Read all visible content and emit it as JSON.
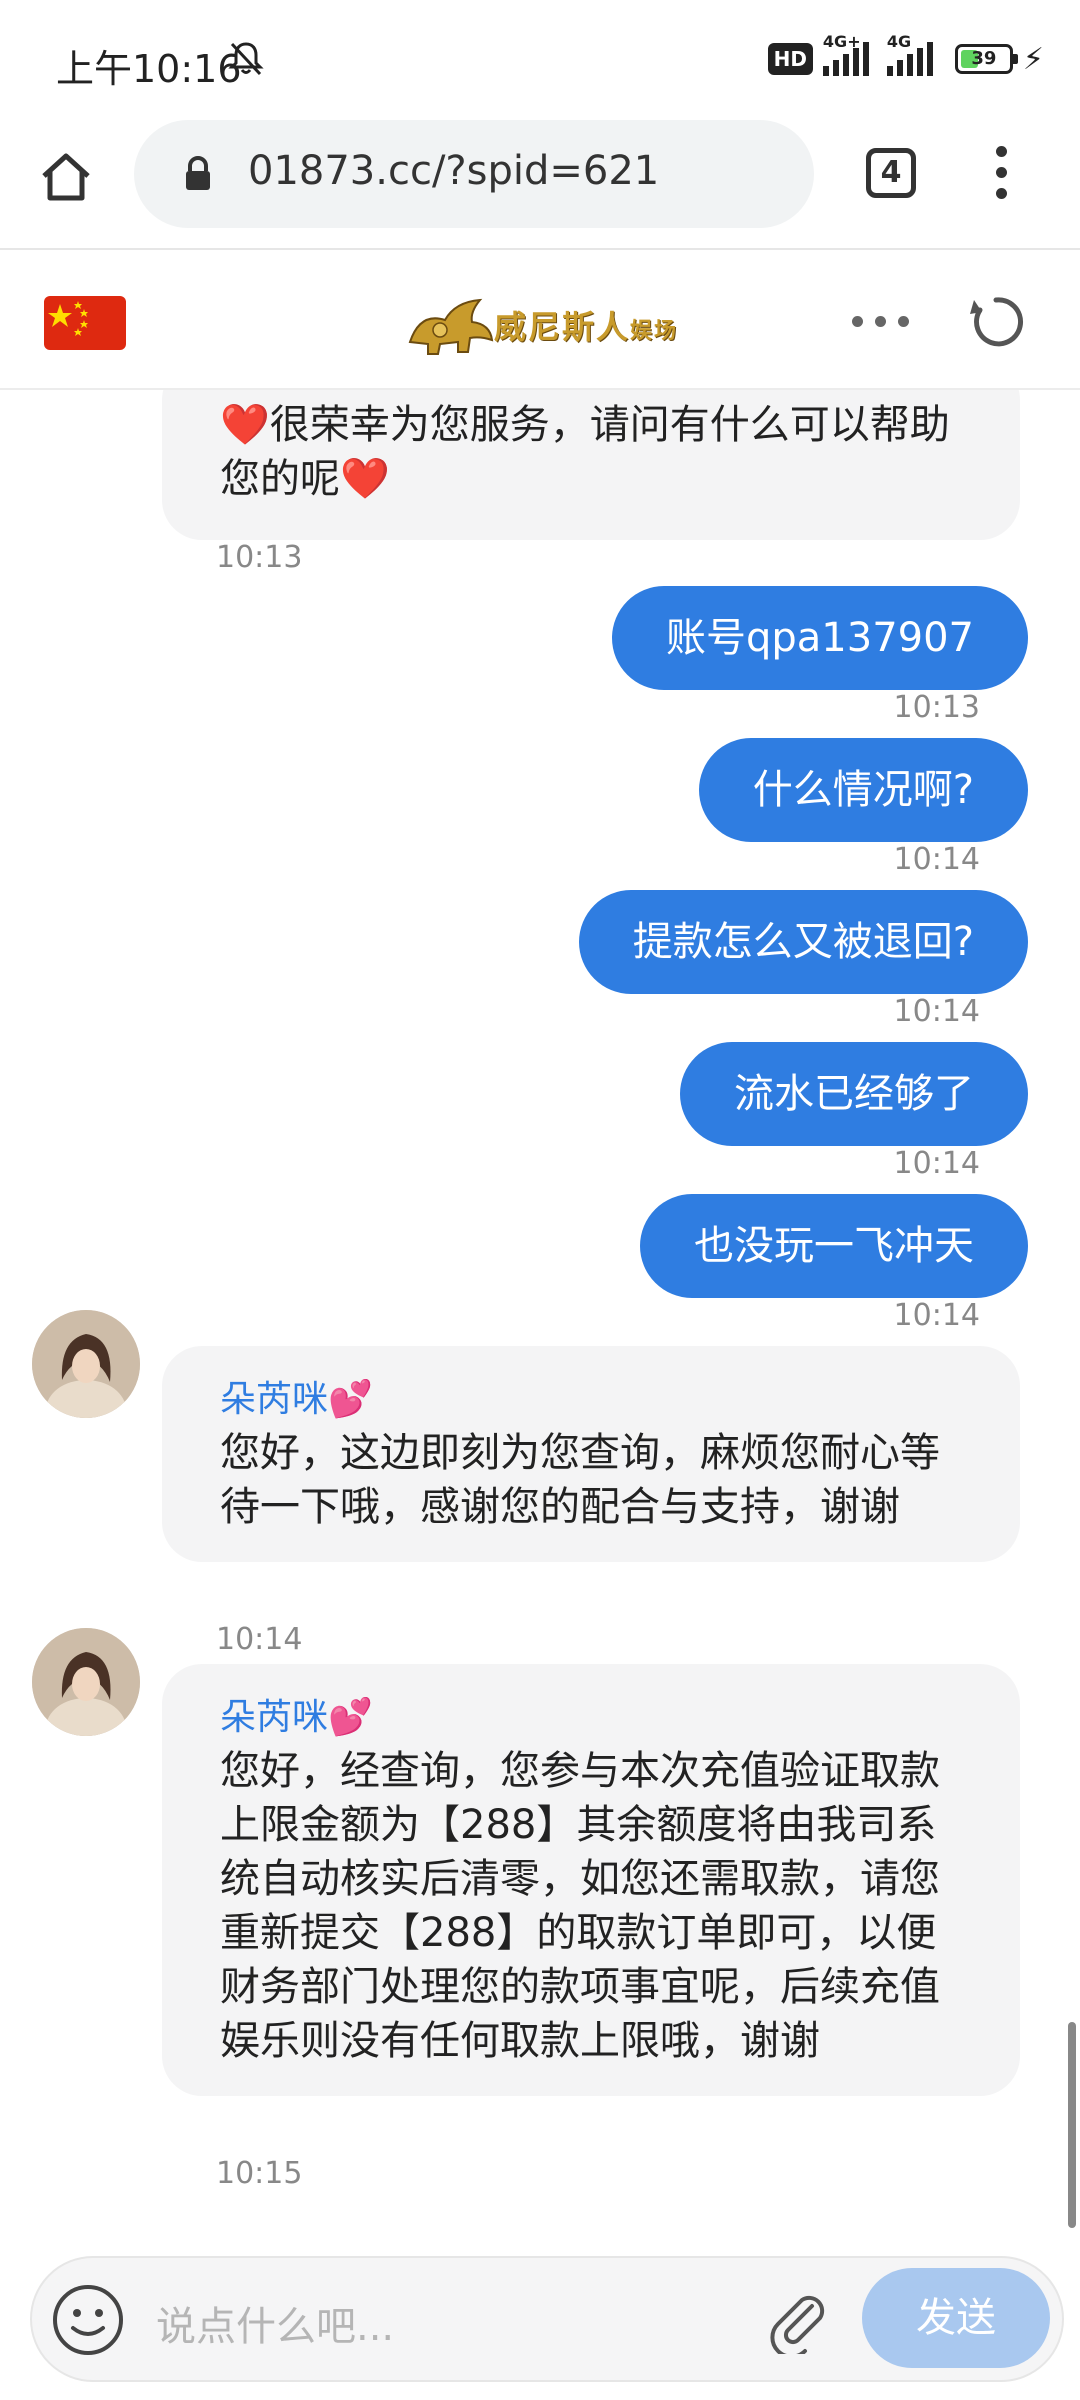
{
  "status_bar": {
    "time": "上午10:16",
    "hd": "HD",
    "sig1_label": "4G+",
    "sig2_label": "4G",
    "battery": "39",
    "battery_level": 0.39
  },
  "browser": {
    "url": "01873.cc/?spid=621",
    "tab_count": "4"
  },
  "app_header": {
    "brand": "威尼斯人",
    "brand_suffix": "娱场"
  },
  "messages": [
    {
      "side": "in",
      "text": "❤️很荣幸为您服务，请问有什么可以帮助您的呢❤️",
      "time": "10:13"
    },
    {
      "side": "out",
      "text": "账号qpa137907",
      "time": "10:13"
    },
    {
      "side": "out",
      "text": "什么情况啊?",
      "time": "10:14"
    },
    {
      "side": "out",
      "text": "提款怎么又被退回?",
      "time": "10:14"
    },
    {
      "side": "out",
      "text": "流水已经够了",
      "time": "10:14"
    },
    {
      "side": "out",
      "text": "也没玩一飞冲天",
      "time": "10:14"
    },
    {
      "side": "in",
      "name": "朵芮咪💕",
      "text": "您好，这边即刻为您查询，麻烦您耐心等待一下哦，感谢您的配合与支持，谢谢",
      "time": "10:14"
    },
    {
      "side": "in",
      "name": "朵芮咪💕",
      "text": "您好，经查询，您参与本次充值验证取款上限金额为【288】其余额度将由我司系统自动核实后清零，如您还需取款，请您重新提交【288】的取款订单即可，以便财务部门处理您的款项事宜呢，后续充值娱乐则没有任何取款上限哦，谢谢",
      "time": "10:15"
    }
  ],
  "input": {
    "placeholder": "说点什么吧...",
    "send_label": "发送"
  },
  "colors": {
    "accent": "#2f7de1",
    "incoming_bubble": "#f4f4f5",
    "send_disabled": "#a9c8ef"
  }
}
